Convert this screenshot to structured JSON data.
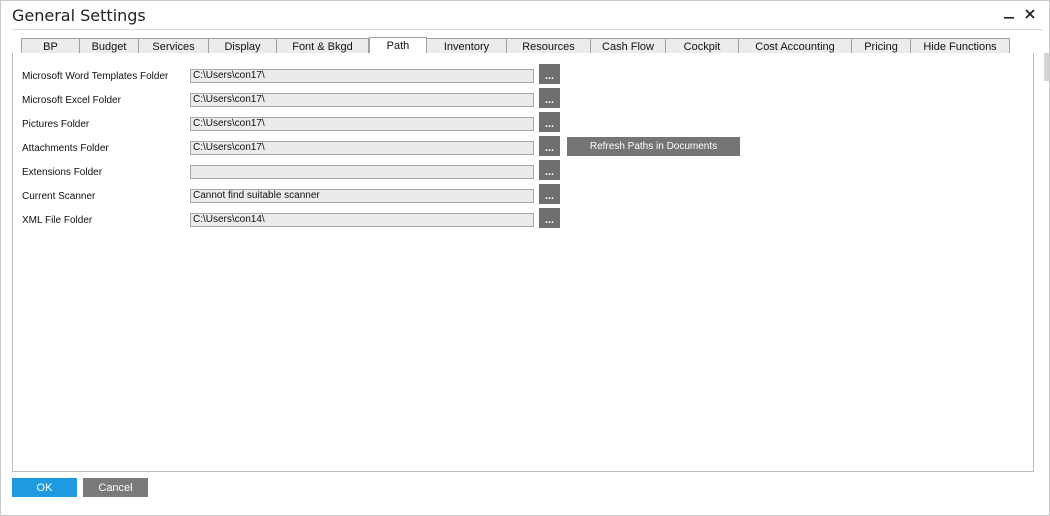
{
  "window": {
    "title": "General Settings",
    "minimize_icon": "minimize-icon",
    "close_icon": "close-icon"
  },
  "tabs": [
    {
      "label": "BP",
      "active": false
    },
    {
      "label": "Budget",
      "active": false
    },
    {
      "label": "Services",
      "active": false
    },
    {
      "label": "Display",
      "active": false
    },
    {
      "label": "Font & Bkgd",
      "active": false
    },
    {
      "label": "Path",
      "active": true
    },
    {
      "label": "Inventory",
      "active": false
    },
    {
      "label": "Resources",
      "active": false
    },
    {
      "label": "Cash Flow",
      "active": false
    },
    {
      "label": "Cockpit",
      "active": false
    },
    {
      "label": "Cost Accounting",
      "active": false
    },
    {
      "label": "Pricing",
      "active": false
    },
    {
      "label": "Hide Functions",
      "active": false
    }
  ],
  "paths": [
    {
      "label": "Microsoft Word Templates Folder",
      "value": "C:\\Users\\con17\\"
    },
    {
      "label": "Microsoft Excel Folder",
      "value": "C:\\Users\\con17\\"
    },
    {
      "label": "Pictures Folder",
      "value": "C:\\Users\\con17\\"
    },
    {
      "label": "Attachments Folder",
      "value": "C:\\Users\\con17\\"
    },
    {
      "label": "Extensions Folder",
      "value": ""
    },
    {
      "label": "Current Scanner",
      "value": "Cannot find suitable scanner"
    },
    {
      "label": "XML File Folder",
      "value": "C:\\Users\\con14\\"
    }
  ],
  "browse_label": "...",
  "refresh_label": "Refresh Paths in Documents",
  "footer": {
    "ok_label": "OK",
    "cancel_label": "Cancel"
  },
  "colors": {
    "ok_button": "#1e9be0",
    "gray_button": "#757575",
    "field_bg": "#ebebeb"
  }
}
